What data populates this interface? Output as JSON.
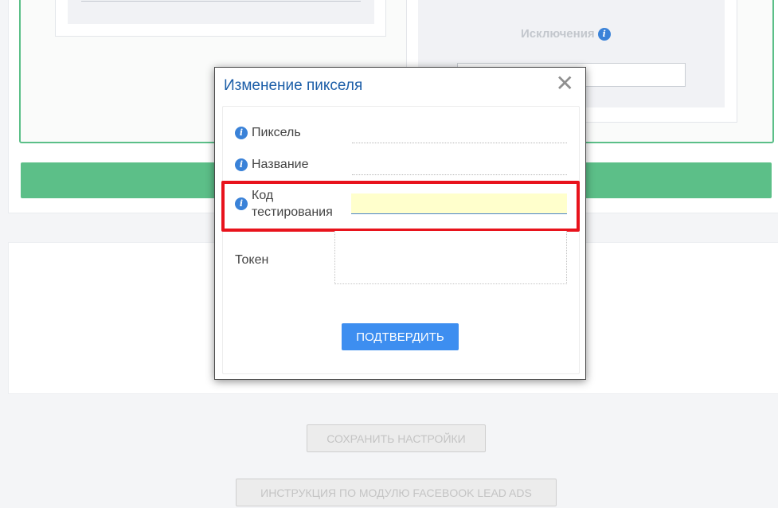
{
  "background": {
    "exclusions_label": "Исключения",
    "save_button": "СОХРАНИТЬ НАСТРОЙКИ",
    "guide_button": "ИНСТРУКЦИЯ ПО МОДУЛЮ FACEBOOK LEAD ADS"
  },
  "modal": {
    "title": "Изменение пикселя",
    "close_symbol": "✕",
    "fields": {
      "pixel_label": "Пиксель",
      "name_label": "Название",
      "test_code_label_line1": "Код",
      "test_code_label_line2": "тестирования",
      "token_label": "Токен"
    },
    "confirm_button": "ПОДТВЕРДИТЬ"
  },
  "icons": {
    "info": "info-icon",
    "close": "close-icon"
  },
  "colors": {
    "accent_blue": "#3d8ef0",
    "title_blue": "#1c5ea8",
    "green": "#5cbf88",
    "highlight_red": "#e8131c",
    "input_yellow": "#ffffcc"
  }
}
